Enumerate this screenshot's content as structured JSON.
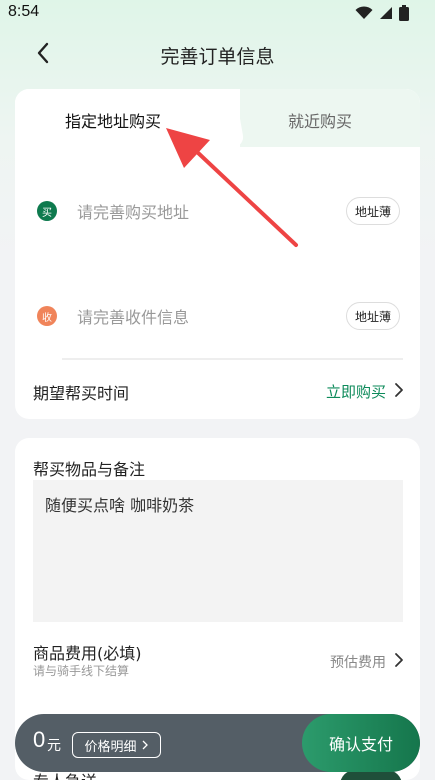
{
  "status_bar": {
    "time": "8:54",
    "icons": [
      "wifi-icon",
      "signal-icon",
      "battery-icon"
    ]
  },
  "nav": {
    "title": "完善订单信息",
    "back_icon": "back-arrow-icon"
  },
  "tabs": [
    {
      "label": "指定地址购买",
      "active": true
    },
    {
      "label": "就近购买",
      "active": false
    }
  ],
  "addresses": {
    "buy": {
      "badge": "买",
      "placeholder": "请完善购买地址",
      "book_label": "地址薄",
      "badge_color": "#0e7a4e"
    },
    "receive": {
      "badge": "收",
      "placeholder": "请完善收件信息",
      "book_label": "地址薄",
      "badge_color": "#f0845a"
    }
  },
  "time_row": {
    "label": "期望帮买时间",
    "value": "立即购买"
  },
  "items": {
    "label": "帮买物品与备注",
    "text": "随便买点啥 咖啡奶茶"
  },
  "fee": {
    "label": "商品费用(必填)",
    "sublabel": "请与骑手线下结算",
    "value": "预估费用"
  },
  "dedicated": {
    "label": "专人急送"
  },
  "bottom": {
    "amount": "0",
    "unit": "元",
    "detail": "价格明细",
    "pay": "确认支付"
  },
  "colors": {
    "accent": "#0c8a5a",
    "arrow": "#ee4444"
  }
}
